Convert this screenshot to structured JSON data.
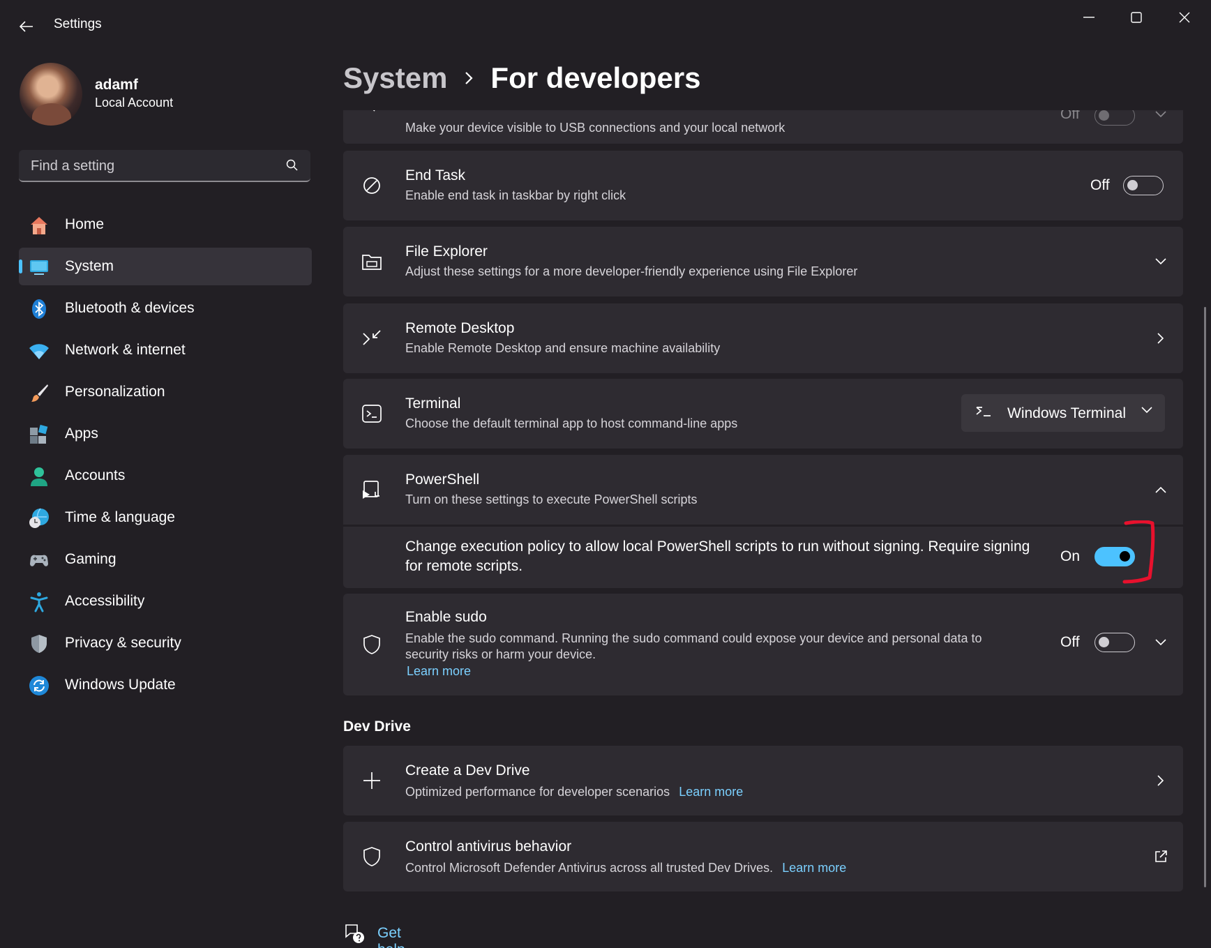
{
  "window": {
    "title": "Settings"
  },
  "user": {
    "name": "adamf",
    "account_type": "Local Account"
  },
  "search": {
    "placeholder": "Find a setting"
  },
  "nav": [
    {
      "label": "Home",
      "icon": "home-icon"
    },
    {
      "label": "System",
      "icon": "system-icon",
      "active": true
    },
    {
      "label": "Bluetooth & devices",
      "icon": "bluetooth-icon"
    },
    {
      "label": "Network & internet",
      "icon": "wifi-icon"
    },
    {
      "label": "Personalization",
      "icon": "brush-icon"
    },
    {
      "label": "Apps",
      "icon": "apps-icon"
    },
    {
      "label": "Accounts",
      "icon": "accounts-icon"
    },
    {
      "label": "Time & language",
      "icon": "time-language-icon"
    },
    {
      "label": "Gaming",
      "icon": "gamepad-icon"
    },
    {
      "label": "Accessibility",
      "icon": "accessibility-icon"
    },
    {
      "label": "Privacy & security",
      "icon": "shield-icon"
    },
    {
      "label": "Windows Update",
      "icon": "update-icon"
    }
  ],
  "breadcrumb": {
    "parent": "System",
    "current": "For developers"
  },
  "cards": {
    "device_discovery": {
      "desc": "Make your device visible to USB connections and your local network",
      "toggle_label": "Off",
      "on": false
    },
    "end_task": {
      "title": "End Task",
      "desc": "Enable end task in taskbar by right click",
      "toggle_label": "Off",
      "on": false
    },
    "file_explorer": {
      "title": "File Explorer",
      "desc": "Adjust these settings for a more developer-friendly experience using File Explorer"
    },
    "remote_desktop": {
      "title": "Remote Desktop",
      "desc": "Enable Remote Desktop and ensure machine availability"
    },
    "terminal": {
      "title": "Terminal",
      "desc": "Choose the default terminal app to host command-line apps",
      "selected": "Windows Terminal"
    },
    "powershell": {
      "title": "PowerShell",
      "desc": "Turn on these settings to execute PowerShell scripts",
      "policy_text_1": "Change execution policy to allow local PowerShell scripts to run without signing. Require signing",
      "policy_text_2": "for remote scripts.",
      "toggle_label": "On",
      "on": true
    },
    "sudo": {
      "title": "Enable sudo",
      "desc_1": "Enable the sudo command. Running the sudo command could expose your device and personal data to",
      "desc_2": "security risks or harm your device.",
      "link": "Learn more",
      "toggle_label": "Off",
      "on": false
    }
  },
  "dev_drive": {
    "section_title": "Dev Drive",
    "create": {
      "title": "Create a Dev Drive",
      "desc": "Optimized performance for developer scenarios",
      "link": "Learn more"
    },
    "antivirus": {
      "title": "Control antivirus behavior",
      "desc": "Control Microsoft Defender Antivirus across all trusted Dev Drives.",
      "link": "Learn more"
    }
  },
  "help": {
    "label": "Get help"
  },
  "colors": {
    "accent": "#4cc2ff",
    "link": "#7bd0ff",
    "annotation": "#e8112d",
    "background": "#221f24",
    "card": "#2e2b31"
  }
}
